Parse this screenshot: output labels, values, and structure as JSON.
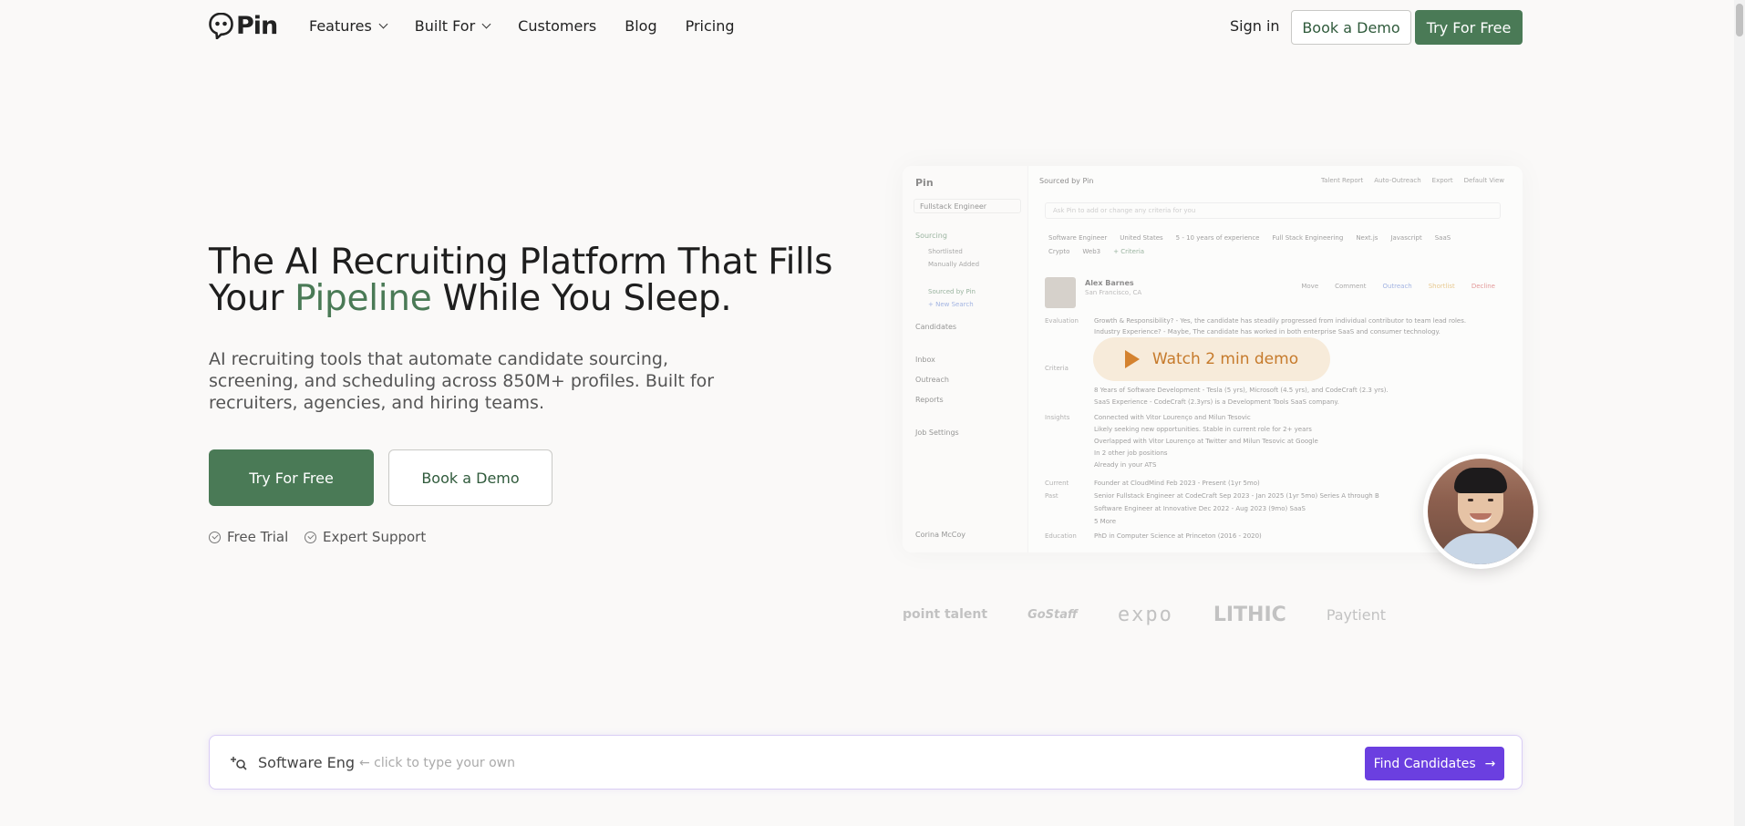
{
  "nav": {
    "logo": "Pin",
    "links": [
      {
        "label": "Features",
        "dropdown": true
      },
      {
        "label": "Built For",
        "dropdown": true
      },
      {
        "label": "Customers",
        "dropdown": false
      },
      {
        "label": "Blog",
        "dropdown": false
      },
      {
        "label": "Pricing",
        "dropdown": false
      }
    ],
    "signin": "Sign in",
    "book_demo": "Book a Demo",
    "try_free": "Try For Free"
  },
  "hero": {
    "title_part1": "The AI Recruiting Platform That Fills Your ",
    "title_accent": "Pipeline",
    "title_part2": " While You Sleep.",
    "subtitle": "AI recruiting tools that automate candidate sourcing, screening, and scheduling across 850M+ profiles. Built for recruiters, agencies, and hiring teams.",
    "cta_primary": "Try For Free",
    "cta_secondary": "Book a Demo",
    "features": [
      "Free Trial",
      "Expert Support"
    ]
  },
  "mock": {
    "logo": "Pin",
    "job": "Fullstack Engineer",
    "sidebar": {
      "sourcing": "Sourcing",
      "shortlisted": "Shortlisted",
      "manually_added": "Manually Added",
      "sourced_by_pin": "Sourced by Pin",
      "new_search": "+ New Search",
      "candidates": "Candidates",
      "inbox": "Inbox",
      "outreach": "Outreach",
      "reports": "Reports",
      "job_settings": "Job Settings",
      "user": "Corina McCoy"
    },
    "top_title": "Sourced by Pin",
    "top_right": [
      "Talent Report",
      "Auto-Outreach",
      "Export",
      "Default View"
    ],
    "ask_placeholder": "Ask Pin to add or change any criteria for you",
    "chips_row1": [
      "Software Engineer",
      "United States",
      "5 - 10 years of experience",
      "Full Stack Engineering",
      "Next.js",
      "Javascript",
      "SaaS"
    ],
    "chips_row2": [
      "Crypto",
      "Web3",
      "+ Criteria"
    ],
    "candidate_name": "Alex Barnes",
    "candidate_location": "San Francisco, CA",
    "actions": [
      "Move",
      "Comment",
      "Outreach",
      "Shortlist",
      "Decline"
    ],
    "rows": [
      {
        "label": "Evaluation",
        "text": "Growth & Responsibility? - Yes, the candidate has steadily progressed from individual contributor to team lead roles."
      },
      {
        "label": "",
        "text": "Industry Experience? - Maybe, The candidate has worked in both enterprise SaaS and consumer technology."
      },
      {
        "label": "Criteria",
        "text": "8 Years of Software Development - Tesla (5 yrs), Microsoft (4.5 yrs), and CodeCraft (2.3 yrs)."
      },
      {
        "label": "",
        "text": "SaaS Experience - CodeCraft (2.3yrs) is a Development Tools SaaS company."
      },
      {
        "label": "Insights",
        "text": "Connected with Vitor Lourenço and Milun Tesovic"
      },
      {
        "label": "",
        "text": "Likely seeking new opportunities. Stable in current role for 2+ years"
      },
      {
        "label": "",
        "text": "Overlapped with Vitor Lourenço at Twitter and Milun Tesovic at Google"
      },
      {
        "label": "",
        "text": "In 2 other job positions"
      },
      {
        "label": "",
        "text": "Already in your ATS"
      },
      {
        "label": "Current",
        "text": "Founder at CloudMind Feb 2023 - Present (1yr 5mo)"
      },
      {
        "label": "Past",
        "text": "Senior Fullstack Engineer at CodeCraft Sep 2023 - Jan 2025 (1yr 5mo) Series A through B"
      },
      {
        "label": "",
        "text": "Software Engineer at Innovative Dec 2022 - Aug 2023 (9mo) SaaS"
      },
      {
        "label": "",
        "text": "5 More"
      },
      {
        "label": "Education",
        "text": "PhD in Computer Science at Princeton (2016 - 2020)"
      }
    ]
  },
  "watch_demo": "Watch 2 min demo",
  "logos": [
    "point talent",
    "GoStaff",
    "expo",
    "LITHIC",
    "Paytient"
  ],
  "search": {
    "value": "Software Eng",
    "hint": "← click to type your own",
    "button": "Find Candidates"
  }
}
